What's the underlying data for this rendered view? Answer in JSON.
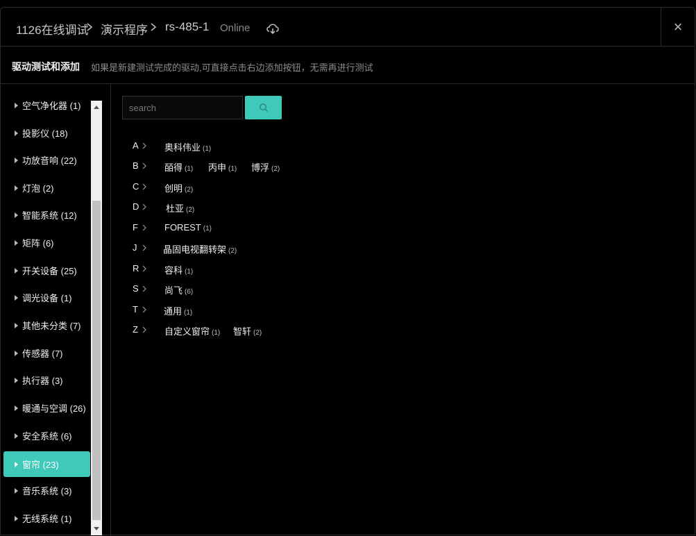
{
  "header": {
    "crumbs": [
      "1126在线调试",
      "演示程序",
      "rs-485-1"
    ],
    "status": "Online",
    "close_label": "×"
  },
  "subbar": {
    "title": "驱动测试和添加",
    "hint": "如果是新建测试完成的驱动,可直接点击右边添加按钮，无需再进行测试"
  },
  "sidebar": {
    "categories": [
      {
        "label": "空气净化器 (1)"
      },
      {
        "label": "投影仪 (18)"
      },
      {
        "label": "功放音响 (22)"
      },
      {
        "label": "灯泡 (2)"
      },
      {
        "label": "智能系统 (12)"
      },
      {
        "label": "矩阵 (6)"
      },
      {
        "label": "开关设备 (25)"
      },
      {
        "label": "调光设备 (1)"
      },
      {
        "label": "其他未分类 (7)"
      },
      {
        "label": "传感器 (7)"
      },
      {
        "label": "执行器 (3)"
      },
      {
        "label": "暖通与空调 (26)"
      },
      {
        "label": "安全系统 (6)"
      },
      {
        "label": "窗帘 (23)"
      },
      {
        "label": "音乐系统 (3)"
      },
      {
        "label": "无线系统 (1)"
      }
    ],
    "active": "窗帘 (23)"
  },
  "search": {
    "placeholder": "search",
    "value": ""
  },
  "brands": [
    {
      "letter": "A",
      "items": [
        {
          "name": "奥科伟业",
          "count": "(1)"
        }
      ]
    },
    {
      "letter": "B",
      "items": [
        {
          "name": "皕得",
          "count": "(1)"
        },
        {
          "name": "丙申",
          "count": "(1)"
        },
        {
          "name": "博浮",
          "count": "(2)"
        }
      ]
    },
    {
      "letter": "C",
      "items": [
        {
          "name": "创明",
          "count": "(2)"
        }
      ]
    },
    {
      "letter": "D",
      "items": [
        {
          "name": "杜亚",
          "count": "(2)"
        }
      ]
    },
    {
      "letter": "F",
      "items": [
        {
          "name": "FOREST",
          "count": "(1)"
        }
      ]
    },
    {
      "letter": "J",
      "items": [
        {
          "name": "晶固电视翻转架",
          "count": "(2)"
        }
      ]
    },
    {
      "letter": "R",
      "items": [
        {
          "name": "容科",
          "count": "(1)"
        }
      ]
    },
    {
      "letter": "S",
      "items": [
        {
          "name": "尚飞",
          "count": "(6)"
        }
      ]
    },
    {
      "letter": "T",
      "items": [
        {
          "name": "通用",
          "count": "(1)"
        }
      ]
    },
    {
      "letter": "Z",
      "items": [
        {
          "name": "自定义窗帘",
          "count": "(1)"
        },
        {
          "name": "智轩",
          "count": "(2)"
        }
      ]
    }
  ],
  "colors": {
    "accent": "#3ec9b9",
    "background": "#000000"
  },
  "icons": {
    "search": "search-icon",
    "cloud": "cloud-sync-icon",
    "close": "close-icon"
  }
}
